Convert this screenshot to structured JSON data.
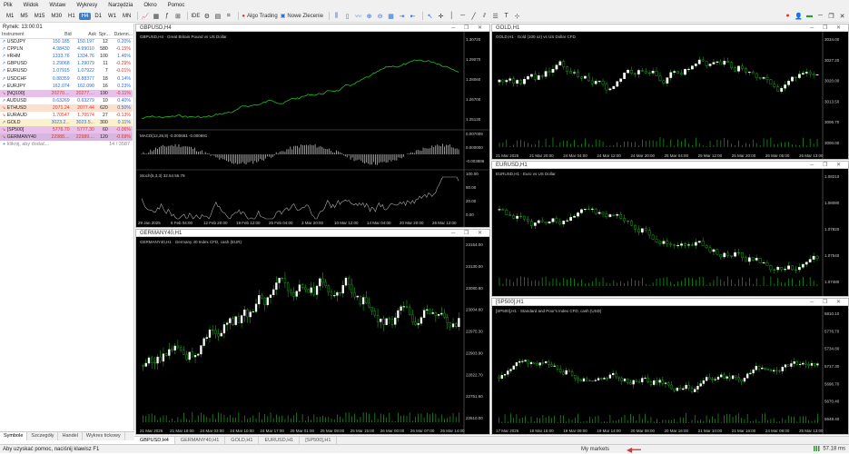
{
  "menu": [
    "Plik",
    "Widok",
    "Wstaw",
    "Wykresy",
    "Narzędzia",
    "Okno",
    "Pomoc"
  ],
  "timeframes": [
    {
      "label": "M1",
      "active": false
    },
    {
      "label": "M5",
      "active": false
    },
    {
      "label": "M15",
      "active": false
    },
    {
      "label": "M30",
      "active": false
    },
    {
      "label": "H1",
      "active": false
    },
    {
      "label": "H4",
      "active": true
    },
    {
      "label": "D1",
      "active": false
    },
    {
      "label": "W1",
      "active": false
    },
    {
      "label": "MN",
      "active": false
    }
  ],
  "toolbar": {
    "ide": "IDE",
    "algo": "Algo Trading",
    "new_order": "Nowe Zlecenie"
  },
  "market_watch": {
    "title": "Rynek: 13:00:01",
    "headers": [
      "Instrument",
      "Bid",
      "Ask",
      "Spr...",
      "Dzienn..."
    ],
    "rows": [
      {
        "symbol": "USDJPY",
        "bid": "150.185",
        "ask": "150.197",
        "spread": "12",
        "change": "0.20%",
        "dir": "up",
        "bg": ""
      },
      {
        "symbol": "CPPLN",
        "bid": "4.98430",
        "ask": "4.99010",
        "spread": "580",
        "change": "-0.15%",
        "dir": "up",
        "bg": ""
      },
      {
        "symbol": "#RHM",
        "bid": "1333.76",
        "ask": "1334.76",
        "spread": "100",
        "change": "1.46%",
        "dir": "up",
        "bg": ""
      },
      {
        "symbol": "GBPUSD",
        "bid": "1.29068",
        "ask": "1.29079",
        "spread": "11",
        "change": "-0.29%",
        "dir": "up",
        "bg": ""
      },
      {
        "symbol": "EURUSD",
        "bid": "1.07915",
        "ask": "1.07922",
        "spread": "7",
        "change": "-0.01%",
        "dir": "up",
        "bg": ""
      },
      {
        "symbol": "USDCHF",
        "bid": "0.88359",
        "ask": "0.88377",
        "spread": "18",
        "change": "0.14%",
        "dir": "up",
        "bg": ""
      },
      {
        "symbol": "EURJPY",
        "bid": "162.074",
        "ask": "162.090",
        "spread": "16",
        "change": "0.23%",
        "dir": "up",
        "bg": ""
      },
      {
        "symbol": "[NQ100]",
        "bid": "20270....",
        "ask": "20277....",
        "spread": "190",
        "change": "-0.11%",
        "dir": "dn",
        "bg": "#e9c0ec"
      },
      {
        "symbol": "AUDUSD",
        "bid": "0.63269",
        "ask": "0.63279",
        "spread": "10",
        "change": "0.40%",
        "dir": "up",
        "bg": ""
      },
      {
        "symbol": "ETHUSD",
        "bid": "2071.24",
        "ask": "2077.44",
        "spread": "620",
        "change": "0.50%",
        "dir": "dn",
        "bg": "#fbe0d0"
      },
      {
        "symbol": "EURAUD",
        "bid": "1.70547",
        "ask": "1.70574",
        "spread": "27",
        "change": "-0.13%",
        "dir": "dn",
        "bg": ""
      },
      {
        "symbol": "GOLD",
        "bid": "3023.2...",
        "ask": "3023.5...",
        "spread": "300",
        "change": "0.11%",
        "dir": "up",
        "bg": "#fbf1cc"
      },
      {
        "symbol": "[SP500]",
        "bid": "5776.70",
        "ask": "5777.30",
        "spread": "60",
        "change": "-0.06%",
        "dir": "dn",
        "bg": "#e9c0ec"
      },
      {
        "symbol": "GERMANY40",
        "bid": "22988....",
        "ask": "22989....",
        "spread": "120",
        "change": "-0.69%",
        "dir": "dn",
        "bg": "#d9b6dd"
      }
    ],
    "add_hint": "kliknij, aby dodać...",
    "count": "14 / 3587",
    "tabs": [
      "Symbole",
      "Szczegóły",
      "Handel",
      "Wykres tickowy"
    ]
  },
  "charts": [
    {
      "id": "gbpusd",
      "title": "GBPUSD,H4",
      "info": "GBPUSD,H4 · Great Britain Pound vs US Dollar",
      "prices": [
        "1.30720",
        "1.29070",
        "1.28060",
        "1.26700",
        "1.25130"
      ],
      "macd_label": "MACD(12,26,9) -0.000651 -0.000691",
      "macd_levels": [
        "0.007009",
        "0.000000",
        "-0.003886"
      ],
      "stoch_label": "Stoch(5,3,3) 32.54 55.79",
      "stoch_levels": [
        "100.00",
        "80.00",
        "20.00",
        "0.00"
      ],
      "dates": [
        "29 Jan 2025",
        "6 Feb 04:00",
        "12 Feb 20:00",
        "19 Feb 12:00",
        "25 Feb 04:00",
        "3 Mar 20:00",
        "10 Mar 12:00",
        "14 Mar 04:00",
        "20 Mar 20:00",
        "26 Mar 12:00"
      ]
    },
    {
      "id": "gold",
      "title": "GOLD,H1",
      "info": "GOLD,H1 · Gold (100 oz) vs US Dollar CFD",
      "prices": [
        "3034.00",
        "3027.20",
        "3020.00",
        "3013.50",
        "3006.70",
        "3000.00"
      ],
      "dates": [
        "21 Mar 2025",
        "21 Mar 20:00",
        "24 Mar 04:00",
        "24 Mar 12:00",
        "24 Mar 20:00",
        "25 Mar 04:00",
        "25 Mar 12:00",
        "25 Mar 20:00",
        "26 Mar 05:00",
        "26 Mar 13:00"
      ]
    },
    {
      "id": "eurusd",
      "title": "EURUSD,H1",
      "info": "EURUSD,H1 · Euro vs US Dollar",
      "prices": [
        "1.08210",
        "1.08080",
        "1.07820",
        "1.07540",
        "1.07480"
      ],
      "dates": []
    },
    {
      "id": "germany40",
      "title": "GERMANY40,H1",
      "info": "GERMANY40,H1 · Germany 40 Index CFD, cash (EUR)",
      "prices": [
        "23154.00",
        "23130.00",
        "23080.80",
        "23004.60",
        "22975.30",
        "22903.90",
        "22822.70",
        "22751.60",
        "22610.00"
      ],
      "dates": [
        "21 Mar 2025",
        "21 Mar 18:00",
        "24 Mar 03:00",
        "24 Mar 10:00",
        "24 Mar 17:00",
        "25 Mar 01:00",
        "25 Mar 08:00",
        "25 Mar 15:00",
        "26 Mar 00:00",
        "26 Mar 07:00",
        "26 Mar 14:00"
      ]
    },
    {
      "id": "sp500",
      "title": "[SP500],H1",
      "info": "[SP500],H1 · Standard and Poor's Index CFD, cash (USD)",
      "prices": [
        "5810.10",
        "5776.70",
        "5734.80",
        "5717.30",
        "5696.70",
        "5670.40",
        "5648.40"
      ],
      "dates": [
        "17 Mar 2025",
        "18 Mar 15:00",
        "19 Mar 09:00",
        "19 Mar 14:00",
        "20 Mar 08:00",
        "20 Mar 16:00",
        "21 Mar 10:00",
        "21 Mar 16:00",
        "24 Mar 09:00",
        "25 Mar 13:00"
      ]
    }
  ],
  "chart_tabs": [
    "GBPUSD,H4",
    "GERMANY40,H1",
    "GOLD,H1",
    "EURUSD,H1",
    "[SP500],H1"
  ],
  "status": {
    "help": "Aby uzyskać pomoc, naciśnij klawisz F1",
    "profile": "My markets",
    "ping": "57.18 ms"
  }
}
